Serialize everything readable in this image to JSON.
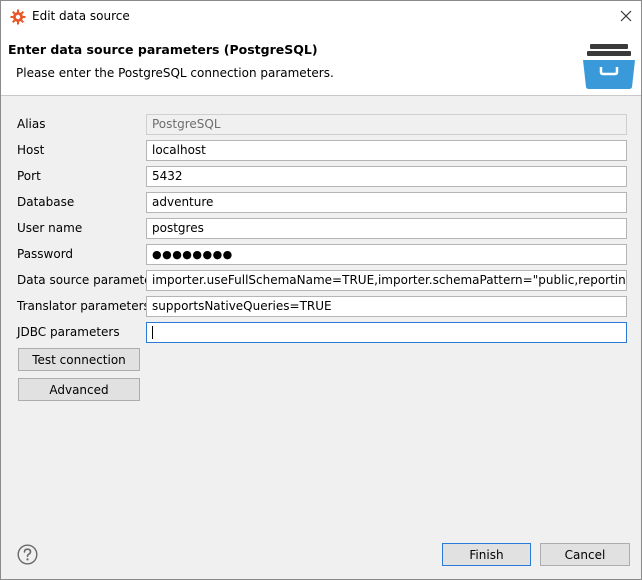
{
  "window": {
    "title": "Edit data source"
  },
  "header": {
    "title": "Enter data source parameters (PostgreSQL)",
    "subtitle": "Please enter the PostgreSQL connection parameters."
  },
  "form": {
    "fields": [
      {
        "label": "Alias",
        "value": "PostgreSQL",
        "disabled": true
      },
      {
        "label": "Host",
        "value": "localhost"
      },
      {
        "label": "Port",
        "value": "5432"
      },
      {
        "label": "Database",
        "value": "adventure"
      },
      {
        "label": "User name",
        "value": "postgres"
      },
      {
        "label": "Password",
        "value": "●●●●●●●●"
      },
      {
        "label": "Data source parameters",
        "value": "importer.useFullSchemaName=TRUE,importer.schemaPattern=\"public,reporting_data\",importer.useCatalogName=FALSE"
      },
      {
        "label": "Translator parameters",
        "value": "supportsNativeQueries=TRUE"
      },
      {
        "label": "JDBC parameters",
        "value": ""
      }
    ]
  },
  "buttons": {
    "test_connection": "Test connection",
    "advanced": "Advanced",
    "finish": "Finish",
    "cancel": "Cancel"
  },
  "colors": {
    "accent": "#2a7bd6",
    "app_icon": "#e8562a",
    "header_icon": "#3a9ad9"
  }
}
